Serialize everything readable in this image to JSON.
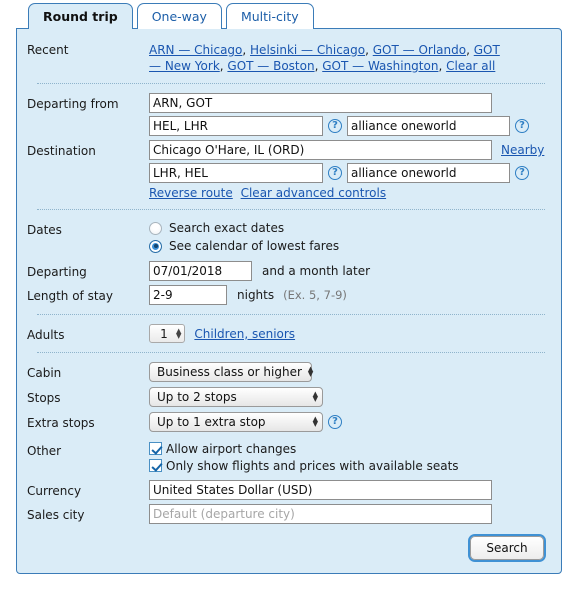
{
  "tabs": [
    {
      "label": "Round trip",
      "active": true
    },
    {
      "label": "One-way",
      "active": false
    },
    {
      "label": "Multi-city",
      "active": false
    }
  ],
  "recent": {
    "label": "Recent",
    "items": [
      "ARN — Chicago",
      "Helsinki — Chicago",
      "GOT — Orlando",
      "GOT — New York",
      "GOT — Boston",
      "GOT — Washington"
    ],
    "clear_all": "Clear all",
    "separator": ", "
  },
  "departing_from": {
    "label": "Departing from",
    "value": "ARN, GOT",
    "via_value": "HEL, LHR",
    "alliance_value": "alliance oneworld",
    "help_icon": "question-mark-icon"
  },
  "destination": {
    "label": "Destination",
    "value": "Chicago O'Hare, IL (ORD)",
    "nearby_label": "Nearby",
    "via_value": "LHR, HEL",
    "alliance_value": "alliance oneworld"
  },
  "advanced_links": {
    "reverse_route": "Reverse route",
    "clear_advanced": "Clear advanced controls"
  },
  "dates": {
    "label": "Dates",
    "options": [
      {
        "label": "Search exact dates",
        "selected": false
      },
      {
        "label": "See calendar of lowest fares",
        "selected": true
      }
    ]
  },
  "departing": {
    "label": "Departing",
    "value": "07/01/2018",
    "suffix": "and a month later"
  },
  "length_of_stay": {
    "label": "Length of stay",
    "value": "2-9",
    "unit": "nights",
    "hint": "(Ex. 5, 7-9)"
  },
  "adults": {
    "label": "Adults",
    "value": "1",
    "link": "Children, seniors"
  },
  "cabin": {
    "label": "Cabin",
    "value": "Business class or higher"
  },
  "stops": {
    "label": "Stops",
    "value": "Up to 2 stops"
  },
  "extra_stops": {
    "label": "Extra stops",
    "value": "Up to 1 extra stop"
  },
  "other": {
    "label": "Other",
    "checkboxes": [
      {
        "label": "Allow airport changes",
        "checked": true
      },
      {
        "label": "Only show flights and prices with available seats",
        "checked": true
      }
    ]
  },
  "currency": {
    "label": "Currency",
    "value": "United States Dollar (USD)"
  },
  "sales_city": {
    "label": "Sales city",
    "value": "",
    "placeholder": "Default (departure city)"
  },
  "search_button": {
    "label": "Search"
  },
  "colors": {
    "panel_bg": "#daecf7",
    "panel_border": "#3b7cb8",
    "link": "#1a56b0",
    "accent": "#3f91d4"
  }
}
